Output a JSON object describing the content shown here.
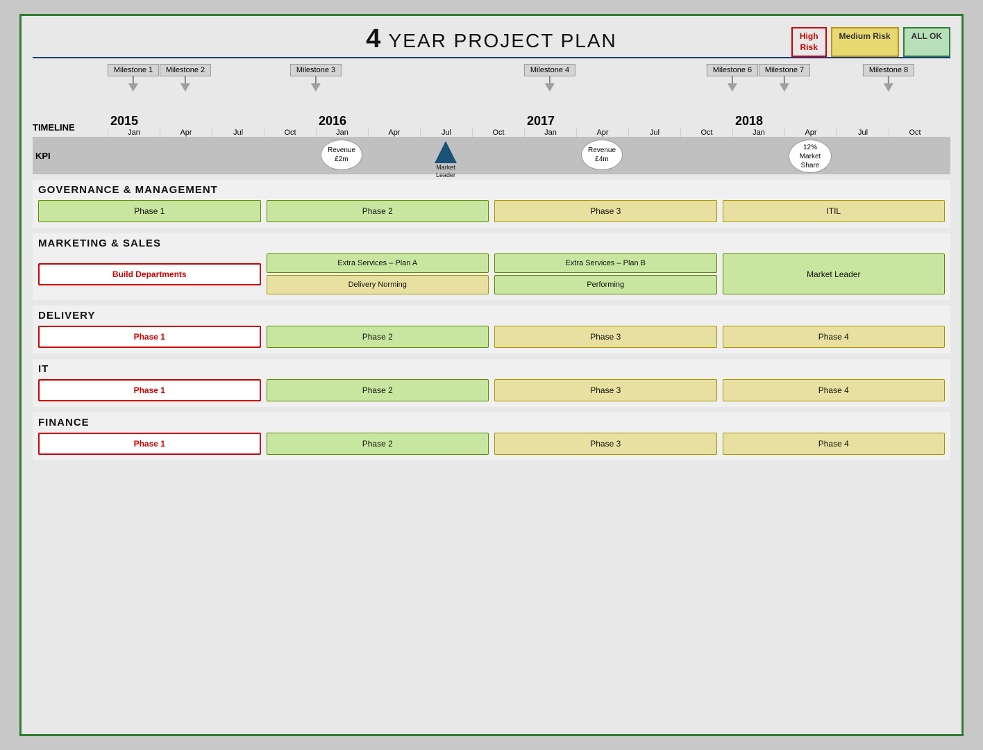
{
  "title": {
    "big": "4",
    "rest": " YEAR PROJECT PLAN"
  },
  "legend": {
    "high_risk": "High\nRisk",
    "medium_risk": "Medium Risk",
    "all_ok": "ALL OK"
  },
  "timeline": {
    "years": [
      "2015",
      "2016",
      "2017",
      "2018"
    ],
    "months": [
      "Jan",
      "Apr",
      "Jul",
      "Oct"
    ],
    "milestones": [
      {
        "label": "Milestone 1",
        "year": 0,
        "month_idx": 0
      },
      {
        "label": "Milestone 2",
        "year": 0,
        "month_idx": 1
      },
      {
        "label": "Milestone 3",
        "year": 1,
        "month_idx": 0
      },
      {
        "label": "Milestone 4",
        "year": 2,
        "month_idx": 1
      },
      {
        "label": "Milestone 6",
        "year": 3,
        "month_idx": 0
      },
      {
        "label": "Milestone 7",
        "year": 3,
        "month_idx": 1
      },
      {
        "label": "Milestone 8",
        "year": 3,
        "month_idx": 3
      }
    ]
  },
  "kpi": {
    "label": "KPI",
    "items": [
      {
        "type": "oval",
        "text": "Revenue\n£2m",
        "year": 1,
        "month_idx": 0
      },
      {
        "type": "triangle",
        "text": "Market\nLeader",
        "year": 1,
        "month_idx": 2
      },
      {
        "type": "oval",
        "text": "Revenue\n£4m",
        "year": 2,
        "month_idx": 1
      },
      {
        "type": "oval",
        "text": "12%\nMarket\nShare",
        "year": 3,
        "month_idx": 1
      }
    ]
  },
  "timeline_label": "TIMELINE",
  "sections": [
    {
      "id": "governance",
      "header": "GOVERNANCE  &  MANAGEMENT",
      "rows": [
        [
          {
            "text": "Phase 1",
            "style": "green",
            "span": 1
          },
          {
            "text": "Phase 2",
            "style": "green",
            "span": 1
          },
          {
            "text": "Phase 3",
            "style": "yellow",
            "span": 1
          },
          {
            "text": "ITIL",
            "style": "yellow",
            "span": 1
          }
        ]
      ]
    },
    {
      "id": "marketing",
      "header": "MARKETING  &  SALES",
      "rows": [
        [
          {
            "text": "Build Departments",
            "style": "red-outline",
            "span": 1
          },
          {
            "text": "Extra Services – Plan A\nDelivery Norming",
            "style": "split-green-yellow",
            "span": 1
          },
          {
            "text": "Extra Services – Plan B\nPerforming",
            "style": "split-green-green",
            "span": 1
          },
          {
            "text": "Market Leader",
            "style": "green-tall",
            "span": 1
          }
        ]
      ]
    },
    {
      "id": "delivery",
      "header": "DELIVERY",
      "rows": [
        [
          {
            "text": "Phase 1",
            "style": "red-outline",
            "span": 1
          },
          {
            "text": "Phase 2",
            "style": "green",
            "span": 1
          },
          {
            "text": "Phase 3",
            "style": "yellow",
            "span": 1
          },
          {
            "text": "Phase 4",
            "style": "yellow",
            "span": 1
          }
        ]
      ]
    },
    {
      "id": "it",
      "header": "IT",
      "rows": [
        [
          {
            "text": "Phase 1",
            "style": "red-outline",
            "span": 1
          },
          {
            "text": "Phase 2",
            "style": "green",
            "span": 1
          },
          {
            "text": "Phase 3",
            "style": "yellow",
            "span": 1
          },
          {
            "text": "Phase 4",
            "style": "yellow",
            "span": 1
          }
        ]
      ]
    },
    {
      "id": "finance",
      "header": "FINANCE",
      "rows": [
        [
          {
            "text": "Phase 1",
            "style": "red-outline",
            "span": 1
          },
          {
            "text": "Phase 2",
            "style": "green",
            "span": 1
          },
          {
            "text": "Phase 3",
            "style": "yellow",
            "span": 1
          },
          {
            "text": "Phase 4",
            "style": "yellow",
            "span": 1
          }
        ]
      ]
    }
  ]
}
